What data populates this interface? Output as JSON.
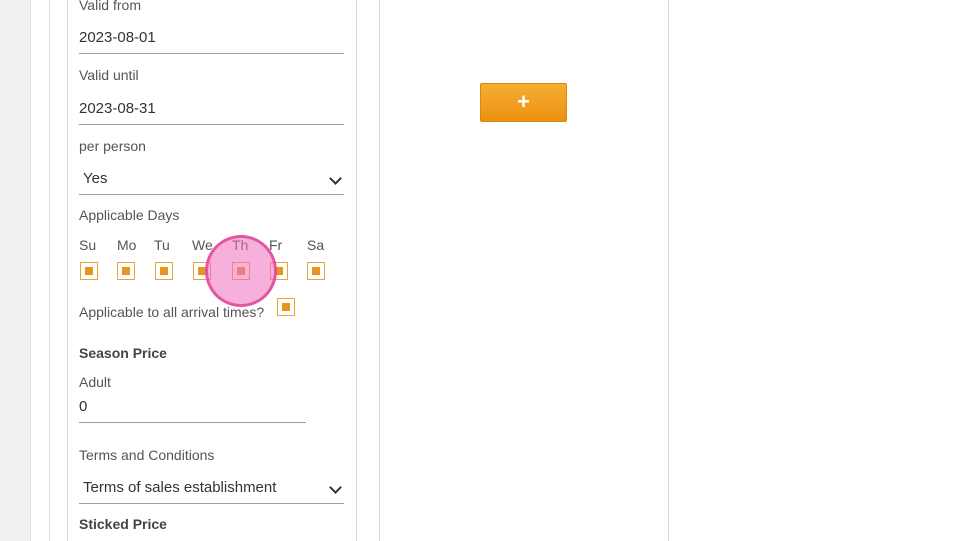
{
  "form": {
    "valid_from_label": "Valid from",
    "valid_from_value": "2023-08-01",
    "valid_until_label": "Valid until",
    "valid_until_value": "2023-08-31",
    "per_person_label": "per person",
    "per_person_value": "Yes",
    "applicable_days_label": "Applicable Days",
    "days": [
      {
        "label": "Su",
        "checked": true
      },
      {
        "label": "Mo",
        "checked": true
      },
      {
        "label": "Tu",
        "checked": true
      },
      {
        "label": "We",
        "checked": true
      },
      {
        "label": "Th",
        "checked": true
      },
      {
        "label": "Fr",
        "checked": true
      },
      {
        "label": "Sa",
        "checked": true
      }
    ],
    "arrival_times_label": "Applicable to all arrival times?",
    "arrival_times_checked": true,
    "season_price_label": "Season Price",
    "adult_label": "Adult",
    "adult_value": "0",
    "terms_label": "Terms and Conditions",
    "terms_value": "Terms of sales establishment",
    "sticked_price_label": "Sticked Price"
  },
  "actions": {
    "add_label": "+"
  },
  "colors": {
    "accent": "#eb920f",
    "checkbox_border": "#e8a33d",
    "touch_indicator": "#f06ebe"
  }
}
